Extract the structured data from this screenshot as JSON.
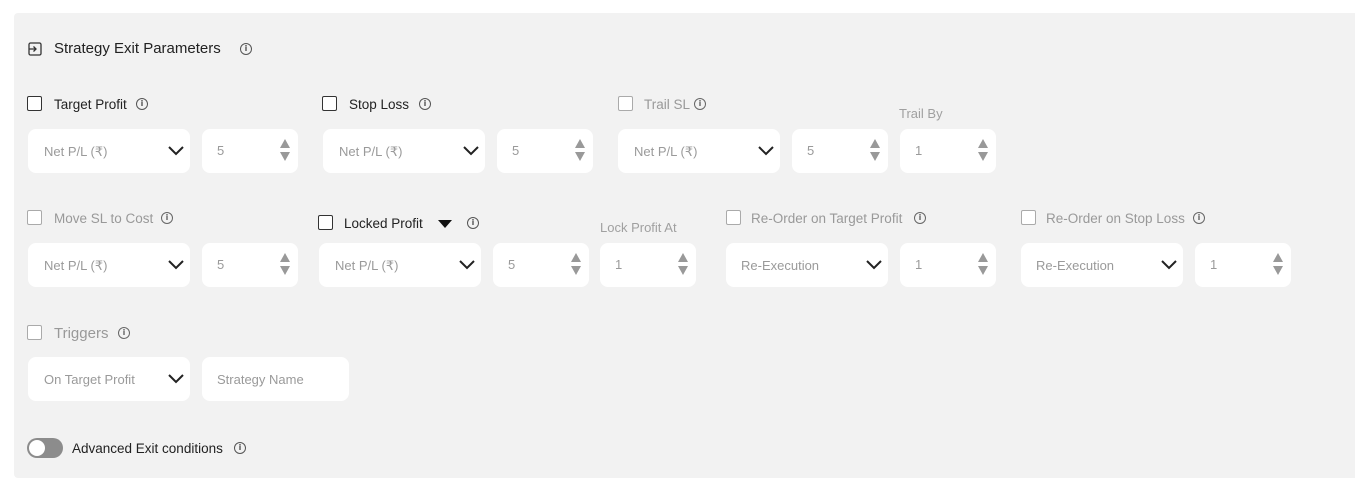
{
  "section": {
    "title": "Strategy Exit Parameters"
  },
  "row1": {
    "target_profit": {
      "label": "Target Profit",
      "select": "Net P/L (₹)",
      "value": "5"
    },
    "stop_loss": {
      "label": "Stop Loss",
      "select": "Net P/L (₹)",
      "value": "5"
    },
    "trail_sl": {
      "label": "Trail SL",
      "select": "Net P/L (₹)",
      "value": "5",
      "trail_by_label": "Trail By",
      "trail_by_value": "1"
    }
  },
  "row2": {
    "move_sl_to_cost": {
      "label": "Move SL to Cost",
      "select": "Net P/L (₹)",
      "value": "5"
    },
    "locked_profit": {
      "label": "Locked Profit",
      "select": "Net P/L (₹)",
      "value": "5",
      "lock_at_label": "Lock Profit At",
      "lock_at_value": "1"
    },
    "reorder_target": {
      "label": "Re-Order on Target Profit",
      "select": "Re-Execution",
      "value": "1"
    },
    "reorder_stop": {
      "label": "Re-Order on Stop Loss",
      "select": "Re-Execution",
      "value": "1"
    }
  },
  "row3": {
    "triggers": {
      "label": "Triggers",
      "select": "On Target Profit",
      "strategy_placeholder": "Strategy Name"
    }
  },
  "advanced": {
    "label": "Advanced Exit conditions",
    "enabled": false
  },
  "icons": {
    "info": "i"
  }
}
